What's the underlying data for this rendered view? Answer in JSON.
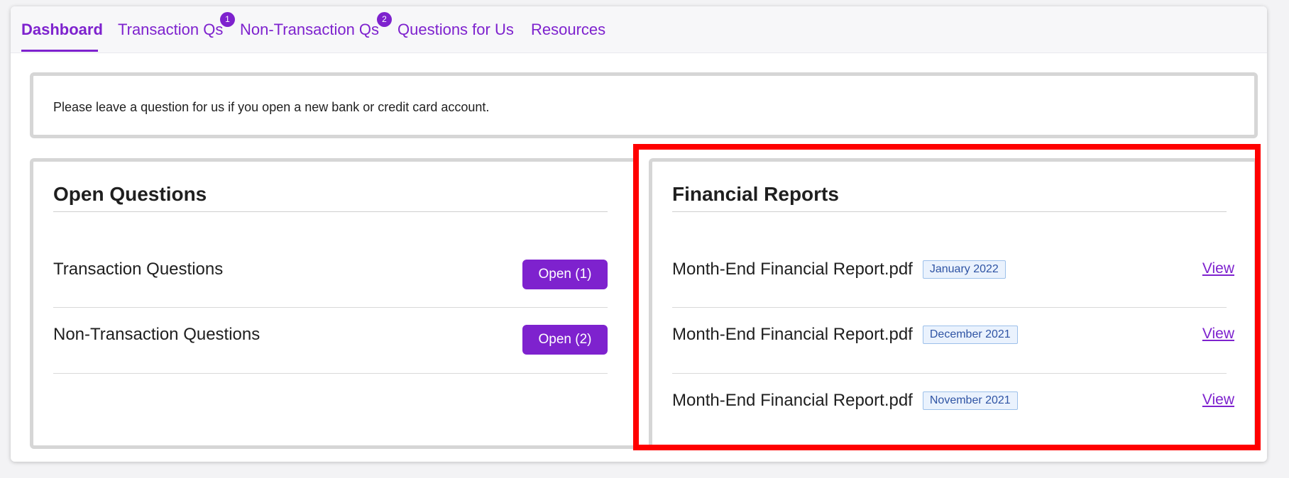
{
  "tabs": [
    {
      "label": "Dashboard"
    },
    {
      "label": "Transaction Qs",
      "badge": "1"
    },
    {
      "label": "Non-Transaction Qs",
      "badge": "2"
    },
    {
      "label": "Questions for Us"
    },
    {
      "label": "Resources"
    }
  ],
  "notice": {
    "text": "Please leave a question for us if you open a new bank or credit card account."
  },
  "open_questions": {
    "title": "Open Questions",
    "rows": [
      {
        "label": "Transaction Questions",
        "button": "Open (1)"
      },
      {
        "label": "Non-Transaction Questions",
        "button": "Open (2)"
      }
    ]
  },
  "financial_reports": {
    "title": "Financial Reports",
    "reports": [
      {
        "file": "Month-End Financial Report.pdf",
        "period": "January 2022",
        "action": "View"
      },
      {
        "file": "Month-End Financial Report.pdf",
        "period": "December 2021",
        "action": "View"
      },
      {
        "file": "Month-End Financial Report.pdf",
        "period": "November 2021",
        "action": "View"
      }
    ]
  },
  "colors": {
    "accent": "#7e22ce",
    "highlight": "#ff0000",
    "tag_bg": "#eaf2fd",
    "tag_text": "#2f54a4"
  }
}
